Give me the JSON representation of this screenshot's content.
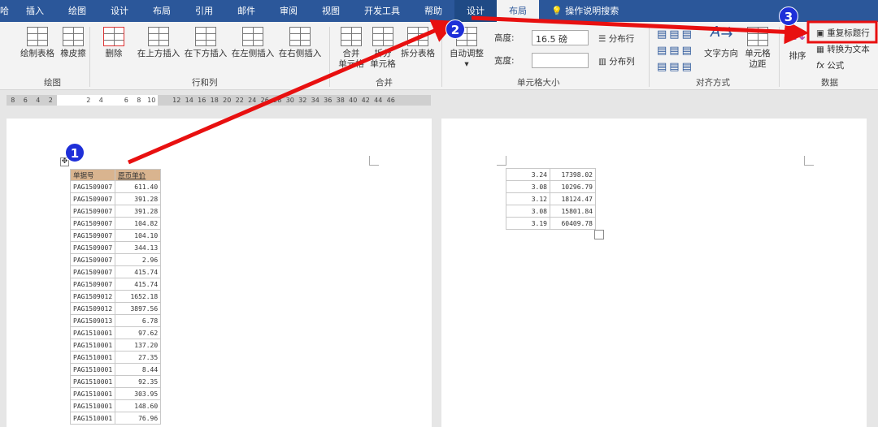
{
  "tabs": [
    "哈",
    "插入",
    "绘图",
    "设计",
    "布局",
    "引用",
    "邮件",
    "审阅",
    "视图",
    "开发工具",
    "帮助",
    "设计",
    "布局"
  ],
  "search": "操作说明搜索",
  "ribbon": {
    "draw": {
      "draw_table": "绘制表格",
      "eraser": "橡皮擦",
      "group": "绘图"
    },
    "rows_cols": {
      "delete": "删除",
      "above": "在上方插入",
      "below": "在下方插入",
      "left": "在左侧插入",
      "right": "在右侧插入",
      "group": "行和列"
    },
    "merge": {
      "merge1": "合并",
      "merge2": "单元格",
      "split1": "拆分",
      "split2": "单元格",
      "split_table": "拆分表格",
      "group": "合并"
    },
    "size": {
      "autofit": "自动调整",
      "height_label": "高度:",
      "height_value": "16.5 磅",
      "width_label": "宽度:",
      "width_value": "",
      "dist_rows": "分布行",
      "dist_cols": "分布列",
      "group": "单元格大小"
    },
    "align": {
      "text_dir": "文字方向",
      "margins1": "单元格",
      "margins2": "边距",
      "group": "对齐方式"
    },
    "data": {
      "sort": "排序",
      "repeat_header": "重复标题行",
      "convert": "转换为文本",
      "formula": "公式",
      "group": "数据"
    }
  },
  "ruler": [
    "8",
    "6",
    "4",
    "2",
    "",
    "",
    "2",
    "4",
    "",
    "6",
    "8",
    "10",
    "",
    "12",
    "14",
    "16",
    "18",
    "20",
    "22",
    "24",
    "26",
    "28",
    "30",
    "32",
    "34",
    "36",
    "38",
    "40",
    "42",
    "44",
    "46"
  ],
  "badges": [
    "1",
    "2",
    "3"
  ],
  "table1": {
    "headers": [
      "单据号",
      "原币单价"
    ],
    "rows": [
      [
        "PAG1509007",
        "611.40"
      ],
      [
        "PAG1509007",
        "391.28"
      ],
      [
        "PAG1509007",
        "391.28"
      ],
      [
        "PAG1509007",
        "104.82"
      ],
      [
        "PAG1509007",
        "104.10"
      ],
      [
        "PAG1509007",
        "344.13"
      ],
      [
        "PAG1509007",
        "2.96"
      ],
      [
        "PAG1509007",
        "415.74"
      ],
      [
        "PAG1509007",
        "415.74"
      ],
      [
        "PAG1509012",
        "1652.18"
      ],
      [
        "PAG1509012",
        "3897.56"
      ],
      [
        "PAG1509013",
        "6.78"
      ],
      [
        "PAG1510001",
        "97.62"
      ],
      [
        "PAG1510001",
        "137.20"
      ],
      [
        "PAG1510001",
        "27.35"
      ],
      [
        "PAG1510001",
        "8.44"
      ],
      [
        "PAG1510001",
        "92.35"
      ],
      [
        "PAG1510001",
        "303.95"
      ],
      [
        "PAG1510001",
        "148.60"
      ],
      [
        "PAG1510001",
        "76.96"
      ]
    ]
  },
  "table2": {
    "rows": [
      [
        "3.24",
        "17398.02"
      ],
      [
        "3.08",
        "10296.79"
      ],
      [
        "3.12",
        "18124.47"
      ],
      [
        "3.08",
        "15801.84"
      ],
      [
        "3.19",
        "60409.78"
      ]
    ]
  },
  "colors": {
    "tabbar": "#2b579a",
    "arrow": "#e81010",
    "badge": "#1e2fd8",
    "header_cell": "#d9b48f"
  }
}
